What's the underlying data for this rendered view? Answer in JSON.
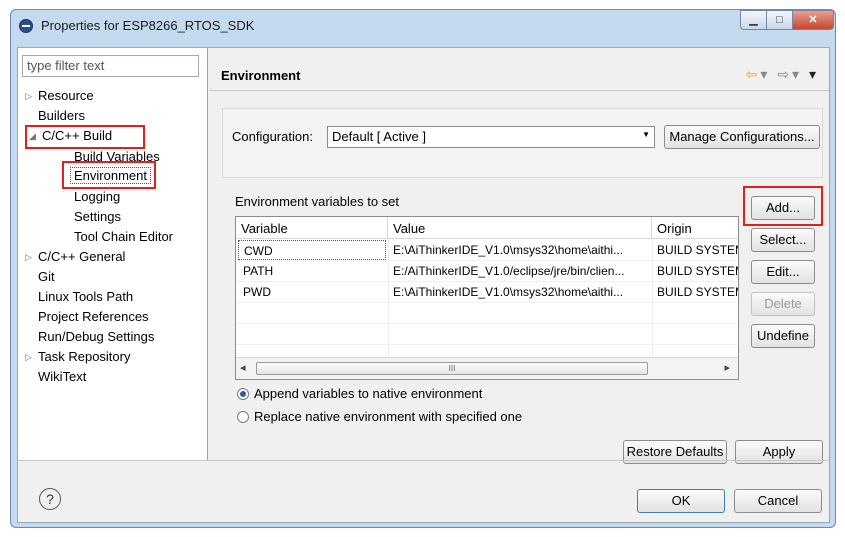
{
  "window": {
    "title": "Properties for ESP8266_RTOS_SDK",
    "min_glyph": "▁",
    "max_glyph": "□",
    "close_glyph": "✕"
  },
  "filter": {
    "placeholder": "type filter text"
  },
  "tree": [
    {
      "label": "Resource",
      "expander": "▷"
    },
    {
      "label": "Builders"
    },
    {
      "label": "C/C++ Build",
      "expander": "◢"
    },
    {
      "label": "Build Variables"
    },
    {
      "label": "Environment"
    },
    {
      "label": "Logging"
    },
    {
      "label": "Settings"
    },
    {
      "label": "Tool Chain Editor"
    },
    {
      "label": "C/C++ General",
      "expander": "▷"
    },
    {
      "label": "Git"
    },
    {
      "label": "Linux Tools Path"
    },
    {
      "label": "Project References"
    },
    {
      "label": "Run/Debug Settings"
    },
    {
      "label": "Task Repository",
      "expander": "▷"
    },
    {
      "label": "WikiText"
    }
  ],
  "page": {
    "title": "Environment",
    "nav_back": "⇦",
    "nav_forward": "⇨",
    "nav_menu": "▾"
  },
  "configuration": {
    "label": "Configuration:",
    "value": "Default  [ Active ]",
    "manage_button": "Manage Configurations..."
  },
  "env": {
    "section_label": "Environment variables to set",
    "columns": [
      "Variable",
      "Value",
      "Origin"
    ],
    "rows": [
      {
        "variable": "CWD",
        "value": "E:\\AiThinkerIDE_V1.0\\msys32\\home\\aithi...",
        "origin": "BUILD SYSTEM"
      },
      {
        "variable": "PATH",
        "value": "E:/AiThinkerIDE_V1.0/eclipse/jre/bin/clien...",
        "origin": "BUILD SYSTEM"
      },
      {
        "variable": "PWD",
        "value": "E:\\AiThinkerIDE_V1.0\\msys32\\home\\aithi...",
        "origin": "BUILD SYSTEM"
      }
    ],
    "scroll_left": "◂",
    "scroll_right": "▸",
    "scroll_grip": "III"
  },
  "buttons": {
    "add": "Add...",
    "select": "Select...",
    "edit": "Edit...",
    "delete": "Delete",
    "undefine": "Undefine",
    "restore_defaults": "Restore Defaults",
    "apply": "Apply",
    "ok": "OK",
    "cancel": "Cancel"
  },
  "radios": {
    "append": "Append variables to native environment",
    "replace": "Replace native environment with specified one",
    "selected": "append"
  },
  "help_glyph": "?"
}
